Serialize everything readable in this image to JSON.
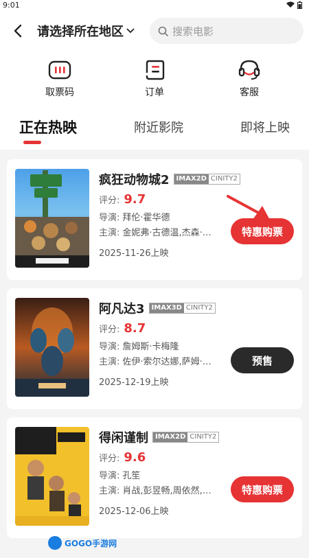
{
  "status": {
    "time": "9:01"
  },
  "header": {
    "region": "请选择所在地区",
    "search_placeholder": "搜索电影"
  },
  "shortcuts": [
    {
      "label": "取票码",
      "icon": "ticket-code-icon"
    },
    {
      "label": "订单",
      "icon": "order-icon"
    },
    {
      "label": "客服",
      "icon": "headset-icon"
    }
  ],
  "tabs": [
    {
      "label": "正在热映",
      "active": true
    },
    {
      "label": "附近影院",
      "active": false
    },
    {
      "label": "即将上映",
      "active": false
    }
  ],
  "movies": [
    {
      "title": "疯狂动物城2",
      "format": "IMAX2D",
      "format2": "CINITY2",
      "score_label": "评分:",
      "score": "9.7",
      "director_label": "导演:",
      "director": "拜伦·霍华德",
      "cast_label": "主演:",
      "cast": "金妮弗·古德温,杰森·贝...",
      "release": "2025-11-26上映",
      "button": "特惠购票",
      "button_color": "#e63334"
    },
    {
      "title": "阿凡达3",
      "format": "IMAX3D",
      "format2": "CINITY2",
      "score_label": "评分:",
      "score": "8.7",
      "director_label": "导演:",
      "director": "詹姆斯·卡梅隆",
      "cast_label": "主演:",
      "cast": "佐伊·索尔达娜,萨姆·沃...",
      "release": "2025-12-19上映",
      "button": "预售",
      "button_color": "#2a2a2a"
    },
    {
      "title": "得闲谨制",
      "format": "IMAX2D",
      "format2": "CINITY2",
      "score_label": "评分:",
      "score": "9.6",
      "director_label": "导演:",
      "director": "孔笙",
      "cast_label": "主演:",
      "cast": "肖战,彭昱畅,周依然,杨新...",
      "release": "2025-12-06上映",
      "button": "特惠购票",
      "button_color": "#e63334"
    }
  ],
  "watermark": "GOGO手游网"
}
